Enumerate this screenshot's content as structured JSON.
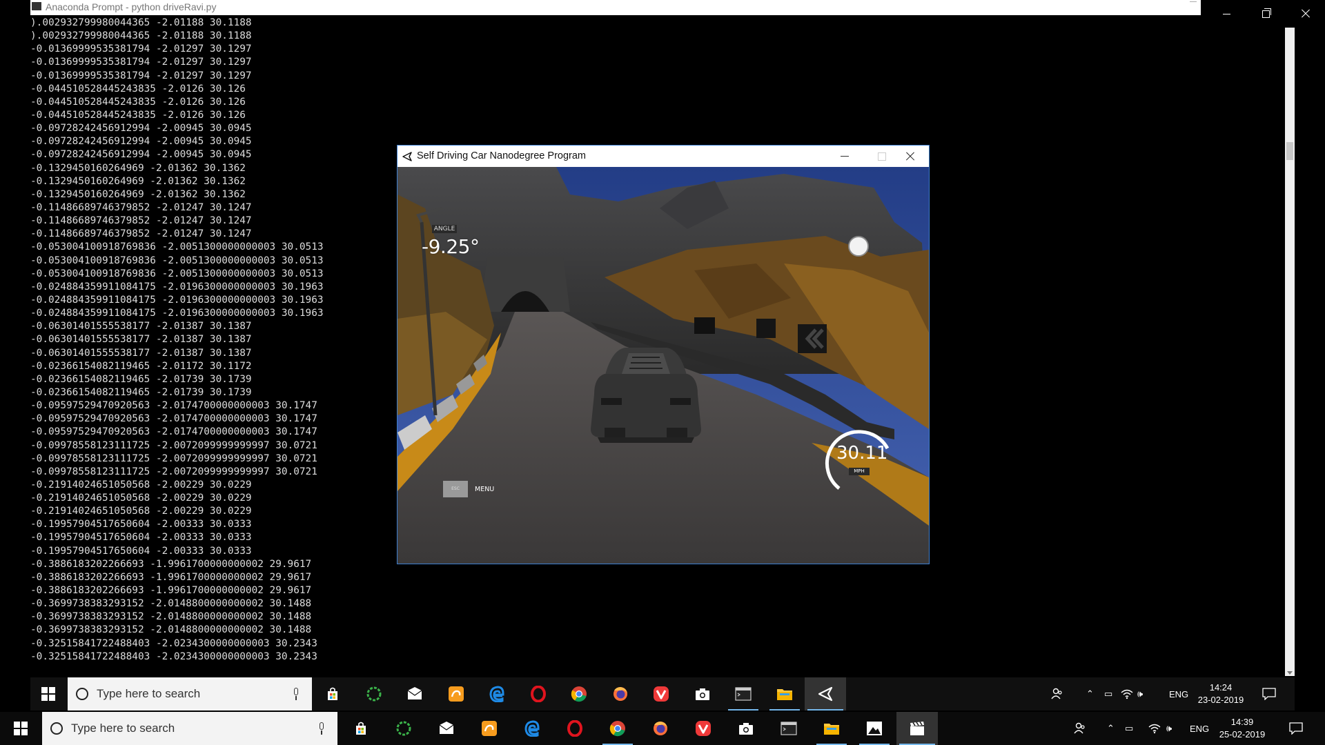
{
  "console": {
    "title": "Anaconda Prompt - python  driveRavi.py",
    "lines": [
      ").002932799980044365 -2.01188 30.1188",
      ").002932799980044365 -2.01188 30.1188",
      "-0.01369999535381794 -2.01297 30.1297",
      "-0.01369999535381794 -2.01297 30.1297",
      "-0.01369999535381794 -2.01297 30.1297",
      "-0.044510528445243835 -2.0126 30.126",
      "-0.044510528445243835 -2.0126 30.126",
      "-0.044510528445243835 -2.0126 30.126",
      "-0.09728242456912994 -2.00945 30.0945",
      "-0.09728242456912994 -2.00945 30.0945",
      "-0.09728242456912994 -2.00945 30.0945",
      "-0.1329450160264969 -2.01362 30.1362",
      "-0.1329450160264969 -2.01362 30.1362",
      "-0.1329450160264969 -2.01362 30.1362",
      "-0.11486689746379852 -2.01247 30.1247",
      "-0.11486689746379852 -2.01247 30.1247",
      "-0.11486689746379852 -2.01247 30.1247",
      "-0.053004100918769836 -2.0051300000000003 30.0513",
      "-0.053004100918769836 -2.0051300000000003 30.0513",
      "-0.053004100918769836 -2.0051300000000003 30.0513",
      "-0.024884359911084175 -2.0196300000000003 30.1963",
      "-0.024884359911084175 -2.0196300000000003 30.1963",
      "-0.024884359911084175 -2.0196300000000003 30.1963",
      "-0.06301401555538177 -2.01387 30.1387",
      "-0.06301401555538177 -2.01387 30.1387",
      "-0.06301401555538177 -2.01387 30.1387",
      "-0.02366154082119465 -2.01172 30.1172",
      "-0.02366154082119465 -2.01739 30.1739",
      "-0.02366154082119465 -2.01739 30.1739",
      "-0.09597529470920563 -2.0174700000000003 30.1747",
      "-0.09597529470920563 -2.0174700000000003 30.1747",
      "-0.09597529470920563 -2.0174700000000003 30.1747",
      "-0.09978558123111725 -2.0072099999999997 30.0721",
      "-0.09978558123111725 -2.0072099999999997 30.0721",
      "-0.09978558123111725 -2.0072099999999997 30.0721",
      "-0.21914024651050568 -2.00229 30.0229",
      "-0.21914024651050568 -2.00229 30.0229",
      "-0.21914024651050568 -2.00229 30.0229",
      "-0.19957904517650604 -2.00333 30.0333",
      "-0.19957904517650604 -2.00333 30.0333",
      "-0.19957904517650604 -2.00333 30.0333",
      "-0.3886183202266693 -1.9961700000000002 29.9617",
      "-0.3886183202266693 -1.9961700000000002 29.9617",
      "-0.3886183202266693 -1.9961700000000002 29.9617",
      "-0.3699738383293152 -2.0148800000000002 30.1488",
      "-0.3699738383293152 -2.0148800000000002 30.1488",
      "-0.3699738383293152 -2.0148800000000002 30.1488",
      "-0.32515841722488403 -2.0234300000000003 30.2343",
      "-0.32515841722488403 -2.0234300000000003 30.2343"
    ]
  },
  "simulator": {
    "title": "Self Driving Car Nanodegree Program",
    "angle_label": "ANGLE",
    "angle_value": "-9.25°",
    "esc_label": "ESC",
    "menu_label": "MENU",
    "speed_value": "30.11",
    "speed_unit": "MPH"
  },
  "taskbar_top": {
    "search_placeholder": "Type here to search",
    "language": "ENG",
    "time": "14:24",
    "date": "23-02-2019"
  },
  "taskbar_bottom": {
    "search_placeholder": "Type here to search",
    "language": "ENG",
    "time": "14:39",
    "date": "25-02-2019"
  },
  "taskbar_apps": [
    "store-icon",
    "cortana-ring-icon",
    "mail-icon",
    "uc-browser-icon",
    "edge-icon",
    "opera-icon",
    "chrome-icon",
    "firefox-icon",
    "vivaldi-icon",
    "camera-icon",
    "terminal-icon",
    "file-explorer-icon",
    "unity-icon",
    "photos-icon",
    "video-editor-icon"
  ],
  "colors": {
    "accent": "#3d7fd1",
    "taskbar_indicator": "#76b9ed",
    "console_text": "#dddddd"
  }
}
